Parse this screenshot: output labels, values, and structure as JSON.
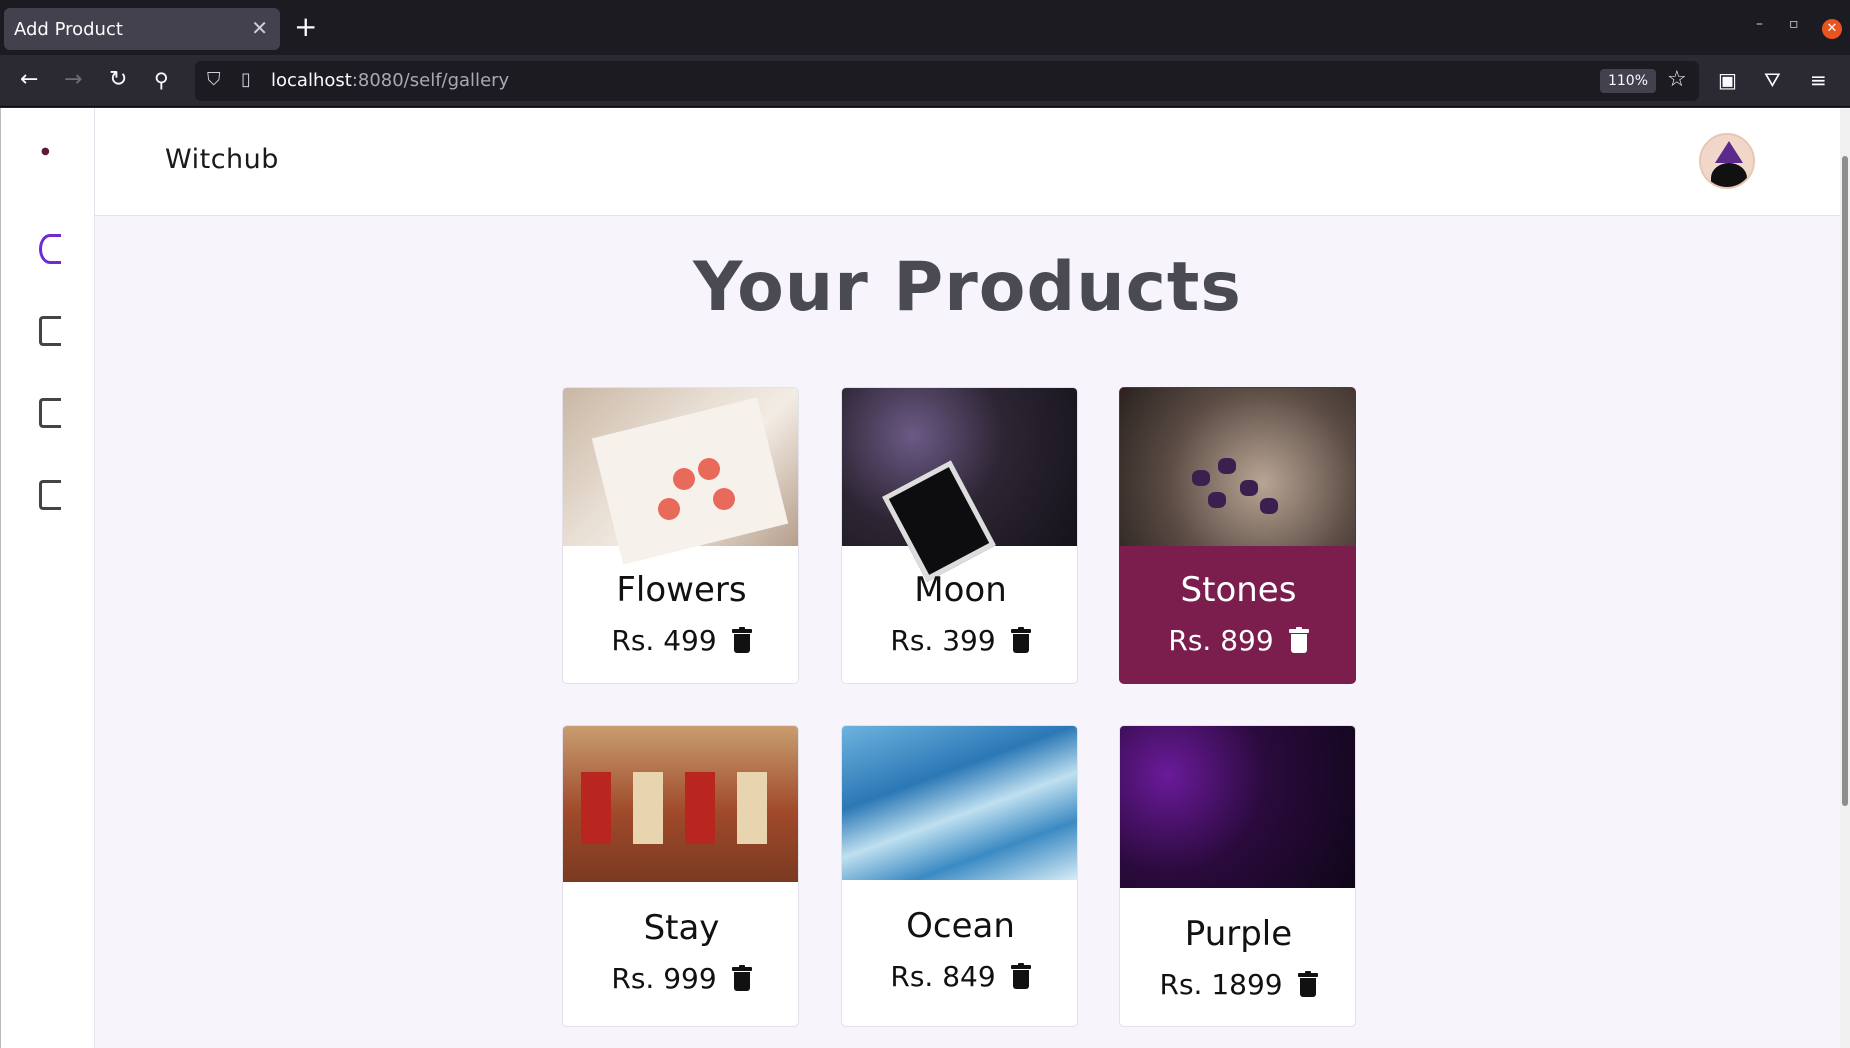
{
  "browser": {
    "tab_title": "Add Product",
    "url_host": "localhost",
    "url_path": ":8080/self/gallery",
    "zoom": "110%"
  },
  "app": {
    "brand": "Witchub",
    "heading": "Your Products"
  },
  "products": [
    {
      "name": "Flowers",
      "price": "Rs. 499",
      "selected": false
    },
    {
      "name": "Moon",
      "price": "Rs. 399",
      "selected": false
    },
    {
      "name": "Stones",
      "price": "Rs. 899",
      "selected": true
    },
    {
      "name": "Stay",
      "price": "Rs. 999",
      "selected": false
    },
    {
      "name": "Ocean",
      "price": "Rs. 849",
      "selected": false
    },
    {
      "name": "Purple",
      "price": "Rs. 1899",
      "selected": false
    }
  ],
  "colors": {
    "accent": "#7b1d4d",
    "sidebar_active": "#6d2ad8",
    "page_bg": "#f7f5fb"
  }
}
